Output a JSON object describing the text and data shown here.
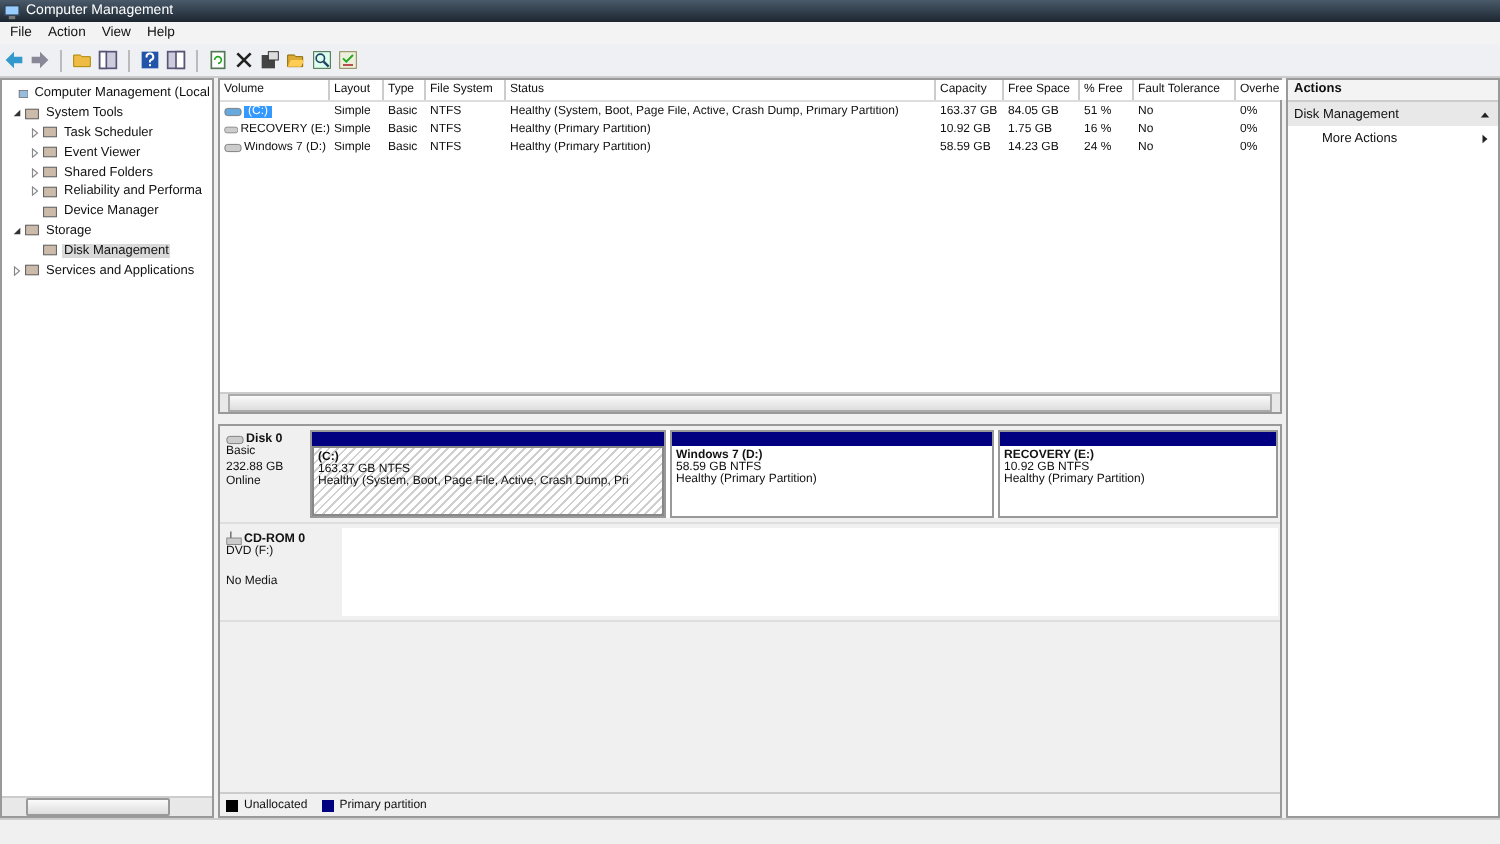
{
  "window": {
    "title": "Computer Management"
  },
  "menu": [
    "File",
    "Action",
    "View",
    "Help"
  ],
  "tree": [
    {
      "label": "Computer Management (Local",
      "selected": false,
      "children": [
        {
          "label": "System Tools",
          "expanded": true,
          "selected": false,
          "children": [
            {
              "label": "Task Scheduler",
              "expanded": false,
              "selected": false
            },
            {
              "label": "Event Viewer",
              "expanded": false,
              "selected": false
            },
            {
              "label": "Shared Folders",
              "expanded": false,
              "selected": false
            },
            {
              "label": "Reliability and Performa",
              "expanded": false,
              "selected": false
            },
            {
              "label": "Device Manager",
              "selected": false
            }
          ]
        },
        {
          "label": "Storage",
          "expanded": true,
          "selected": false,
          "children": [
            {
              "label": "Disk Management",
              "selected": true
            }
          ]
        },
        {
          "label": "Services and Applications",
          "expanded": false,
          "selected": false
        }
      ]
    }
  ],
  "volumes": {
    "columns": [
      "Volume",
      "Layout",
      "Type",
      "File System",
      "Status",
      "Capacity",
      "Free Space",
      "% Free",
      "Fault Tolerance",
      "Overhe"
    ],
    "rows": [
      {
        "selected": true,
        "cells": [
          "(C:)",
          "Simple",
          "Basic",
          "NTFS",
          "Healthy (System, Boot, Page File, Active, Crash Dump, Primary Partition)",
          "163.37 GB",
          "84.05 GB",
          "51 %",
          "No",
          "0%"
        ]
      },
      {
        "selected": false,
        "cells": [
          "RECOVERY (E:)",
          "Simple",
          "Basic",
          "NTFS",
          "Healthy (Primary Partition)",
          "10.92 GB",
          "1.75 GB",
          "16 %",
          "No",
          "0%"
        ]
      },
      {
        "selected": false,
        "cells": [
          "Windows 7 (D:)",
          "Simple",
          "Basic",
          "NTFS",
          "Healthy (Primary Partition)",
          "58.59 GB",
          "14.23 GB",
          "24 %",
          "No",
          "0%"
        ]
      }
    ]
  },
  "disks": [
    {
      "kind": "hdd",
      "name": "Disk 0",
      "lines": [
        "Basic",
        "232.88 GB",
        "Online"
      ],
      "partitions": [
        {
          "name": "(C:)",
          "size": "163.37 GB NTFS",
          "status": "Healthy (System, Boot, Page File, Active, Crash Dump, Pri",
          "selected": true
        },
        {
          "name": "Windows 7  (D:)",
          "size": "58.59 GB NTFS",
          "status": "Healthy (Primary Partition)",
          "selected": false
        },
        {
          "name": "RECOVERY  (E:)",
          "size": "10.92 GB NTFS",
          "status": "Healthy (Primary Partition)",
          "selected": false
        }
      ]
    },
    {
      "kind": "cdrom",
      "name": "CD-ROM 0",
      "lines": [
        "DVD (F:)",
        "No Media"
      ]
    }
  ],
  "legend": [
    {
      "label": "Unallocated",
      "color": "#000000"
    },
    {
      "label": "Primary partition",
      "color": "#000080"
    }
  ],
  "actions": {
    "title": "Actions",
    "section": "Disk Management",
    "items": [
      "More Actions"
    ]
  }
}
